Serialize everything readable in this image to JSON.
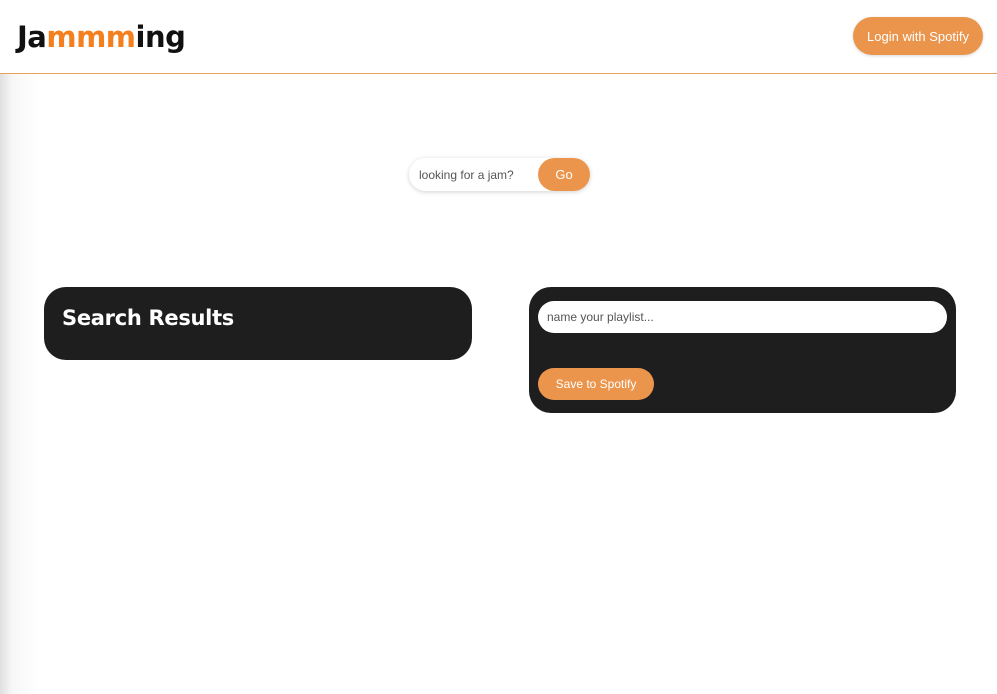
{
  "header": {
    "logo": {
      "part1": "Ja",
      "part2": "mmm",
      "part3": "ing"
    },
    "login_label": "Login with Spotify"
  },
  "search": {
    "placeholder": "looking for a jam?",
    "go_label": "Go"
  },
  "results": {
    "title": "Search Results"
  },
  "playlist": {
    "name_placeholder": "name your playlist...",
    "save_label": "Save to Spotify"
  },
  "colors": {
    "accent": "#eb954c",
    "logo_accent": "#f47f1f",
    "panel_background": "#1e1e1e",
    "header_border": "#e8a15c"
  }
}
